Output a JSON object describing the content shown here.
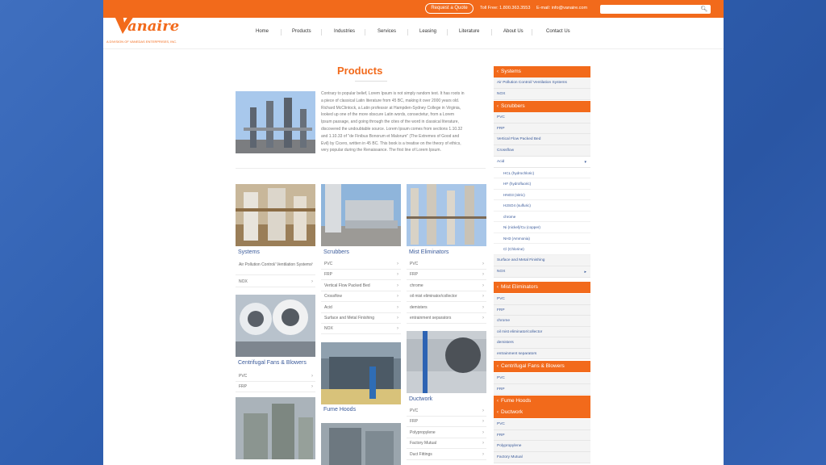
{
  "topbar": {
    "quote_label": "Request a Quote",
    "tollfree": "Toll Free: 1.800.363.3553",
    "email": "E-mail: info@vanaire.com"
  },
  "logo": {
    "word": "anaire",
    "tagline": "A DIVISION OF VANEDAS ENTERPRISES, INC."
  },
  "nav": [
    "Home",
    "Products",
    "Industries",
    "Services",
    "Leasing",
    "Literature",
    "About Us",
    "Contact Us"
  ],
  "main": {
    "title": "Products",
    "intro": "Contrary to popular belief, Lorem Ipsum is not simply random text. It has roots in a piece of classical Latin literature from 45 BC, making it over 2000 years old. Richard McClintock, a Latin professor at Hampden-Sydney College in Virginia, looked up one of the more obscure Latin words, consectetur, from a Lorem Ipsum passage, and going through the cites of the word in classical literature, discovered the undoubtable source. Lorem Ipsum comes from sections 1.10.32 and 1.10.33 of \"de Finibus Bonorum et Malorum\" (The Extremes of Good and Evil) by Cicero, written in 45 BC. This book is a treatise on the theory of ethics, very popular during the Renaissance. The first line of Lorem Ipsum.",
    "cards": [
      {
        "title": "Systems",
        "items": [
          "Air Pollution Control/ Ventilation Systems",
          "NOX"
        ]
      },
      {
        "title": "Scrubbers",
        "items": [
          "PVC",
          "FRP",
          "Vertical Flow Packed Bed",
          "Crossflow",
          "Acid",
          "Surface and Metal Finishing",
          "NOX"
        ]
      },
      {
        "title": "Mist Eliminators",
        "items": [
          "PVC",
          "FRP",
          "chrome",
          "oil mist eliminator/collector",
          "demisters",
          "entrainment separators"
        ]
      },
      {
        "title": "Centrifugal Fans & Blowers",
        "items": [
          "PVC",
          "FRP"
        ]
      },
      {
        "title": "Fume Hoods",
        "items": []
      },
      {
        "title": "Ductwork",
        "items": [
          "PVC",
          "FRP",
          "Polypropylene",
          "Factory Mutual",
          "Duct Fittings"
        ]
      }
    ]
  },
  "sidebar": {
    "systems": {
      "head": "Systems",
      "items": [
        "Air Pollution Control/ Ventilation Systems",
        "NOX"
      ]
    },
    "scrubbers": {
      "head": "Scrubbers",
      "items": [
        "PVC",
        "FRP",
        "Vertical Flow Packed Bed",
        "Crossflow",
        "Acid"
      ],
      "acid_sub": [
        "HCL (hydrochloric)",
        "HF (hydrofluoric)",
        "HNO3 (nitric)",
        "H2SO4 (sulfuric)",
        "chrome",
        "Ni (nickel)/Cu (copper)",
        "NH3 (Ammonia)",
        "Cl (Chlorine)"
      ],
      "after": [
        "Surface and Metal Finishing",
        "NOX"
      ]
    },
    "mist": {
      "head": "Mist Eliminators",
      "items": [
        "PVC",
        "FRP",
        "chrome",
        "oil mist eliminator/collector",
        "demisters",
        "entrainment separators"
      ]
    },
    "fans": {
      "head": "Centrifugal Fans & Blowers",
      "items": [
        "PVC",
        "FRP"
      ]
    },
    "hoods": {
      "head": "Fume Hoods"
    },
    "duct": {
      "head": "Ductwork",
      "items": [
        "PVC",
        "FRP",
        "Polypropylene",
        "Factory Mutual"
      ]
    }
  },
  "colors": {
    "accent": "#f26a1b",
    "link": "#3a5a9a"
  },
  "icons": {
    "search": "search-icon",
    "chevron": "chevron-right-icon",
    "caret": "caret-down-icon"
  }
}
